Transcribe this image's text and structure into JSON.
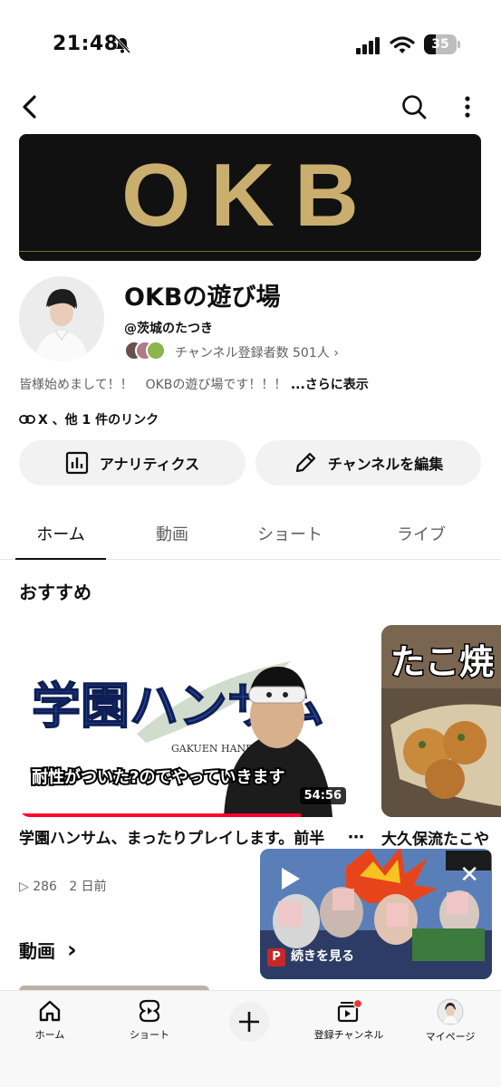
{
  "status_bar": {
    "time": "21:48",
    "battery": "35",
    "battery_level": 0.35
  },
  "channel": {
    "banner_text": "OKB",
    "name": "OKBの遊び場",
    "handle": "@茨城のたつき",
    "subscribers": "チャンネル登録者数 501人 ›",
    "description": "皆様始めまして！！　OKBの遊び場です！！！",
    "description_more": "...さらに表示",
    "links": "X 、他 1 件のリンク"
  },
  "actions": {
    "analytics": "アナリティクス",
    "edit": "チャンネルを編集"
  },
  "tabs": [
    {
      "label": "ホーム",
      "active": true
    },
    {
      "label": "動画",
      "active": false
    },
    {
      "label": "ショート",
      "active": false
    },
    {
      "label": "ライブ",
      "active": false
    }
  ],
  "recommended": {
    "title": "おすすめ",
    "videos": [
      {
        "thumb_title": "学園ハンサム",
        "thumb_sub": "GAKUEN HANDSOME",
        "thumb_caption": "耐性がついた?のでやっていきます",
        "duration": "54:56",
        "progress": 0.82,
        "title": "学園ハンサム、まったりプレイします。前半",
        "views": "▷ 286",
        "age": "2 日前",
        "menu": "⋯"
      },
      {
        "thumb_title": "たこ焼",
        "title": "大久保流たこや"
      }
    ]
  },
  "videos_section": {
    "title": "動画",
    "chevron": "›"
  },
  "miniplayer": {
    "label": "続きを見る",
    "badge": "P",
    "close": "✕"
  },
  "bottom_nav": [
    {
      "label": "ホーム",
      "icon": "home-icon"
    },
    {
      "label": "ショート",
      "icon": "shorts-icon"
    },
    {
      "label": "",
      "icon": "create-icon"
    },
    {
      "label": "登録チャンネル",
      "icon": "subscriptions-icon"
    },
    {
      "label": "マイページ",
      "icon": "account-icon"
    }
  ],
  "colors": {
    "accent": "#ff0033",
    "banner_gold": "#c9ae6e",
    "text": "#0f0f0f",
    "muted": "#606060"
  }
}
